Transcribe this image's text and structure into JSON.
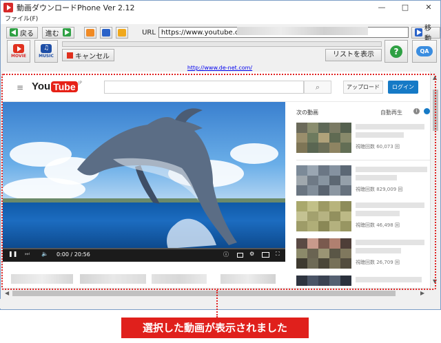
{
  "window": {
    "title": "動画ダウンロードPhone Ver 2.12",
    "minimize": "—",
    "maximize": "□",
    "close": "✕"
  },
  "menu": {
    "file": "ファイル(F)"
  },
  "toolbar": {
    "back_label": "戻る",
    "forward_label": "進む",
    "url_label": "URL",
    "url_value": "https://www.youtube.com/",
    "go_label": "移動"
  },
  "toolbar2": {
    "movie_label": "MOVIE",
    "music_label": "MUSIC",
    "music_glyph": "♫",
    "cancel_label": "キャンセル",
    "list_label": "リストを表示",
    "help_glyph": "?",
    "qa_glyph": "QA"
  },
  "site_link": "http://www.de-net.com/",
  "youtube": {
    "hamburger": "≡",
    "logo_you": "You",
    "logo_tube": "Tube",
    "logo_region": "JP",
    "search_glyph": "⌕",
    "upload_label": "アップロード",
    "login_label": "ログイン",
    "player": {
      "time": "0:00 / 20:56",
      "play_glyph": "❚❚",
      "next_glyph": "⏭",
      "volume_glyph": "🔈",
      "info_glyph": "ⓘ",
      "settings_glyph": "⚙",
      "fullscreen_glyph": "⛶"
    },
    "sidebar": {
      "next_label": "次の動画",
      "autoplay_label": "自動再生",
      "info_glyph": "i",
      "items": [
        {
          "views": ""
        },
        {
          "views": "視聴回数 60,073 回"
        },
        {
          "views": "視聴回数 829,009 回"
        },
        {
          "views": "視聴回数 46,498 回"
        },
        {
          "views": "視聴回数 26,709 回"
        }
      ]
    }
  },
  "callout": "選択した動画が表示されました",
  "colors": {
    "accent_red": "#e0201c",
    "youtube_blue": "#167ac6",
    "green": "#2ea043"
  }
}
